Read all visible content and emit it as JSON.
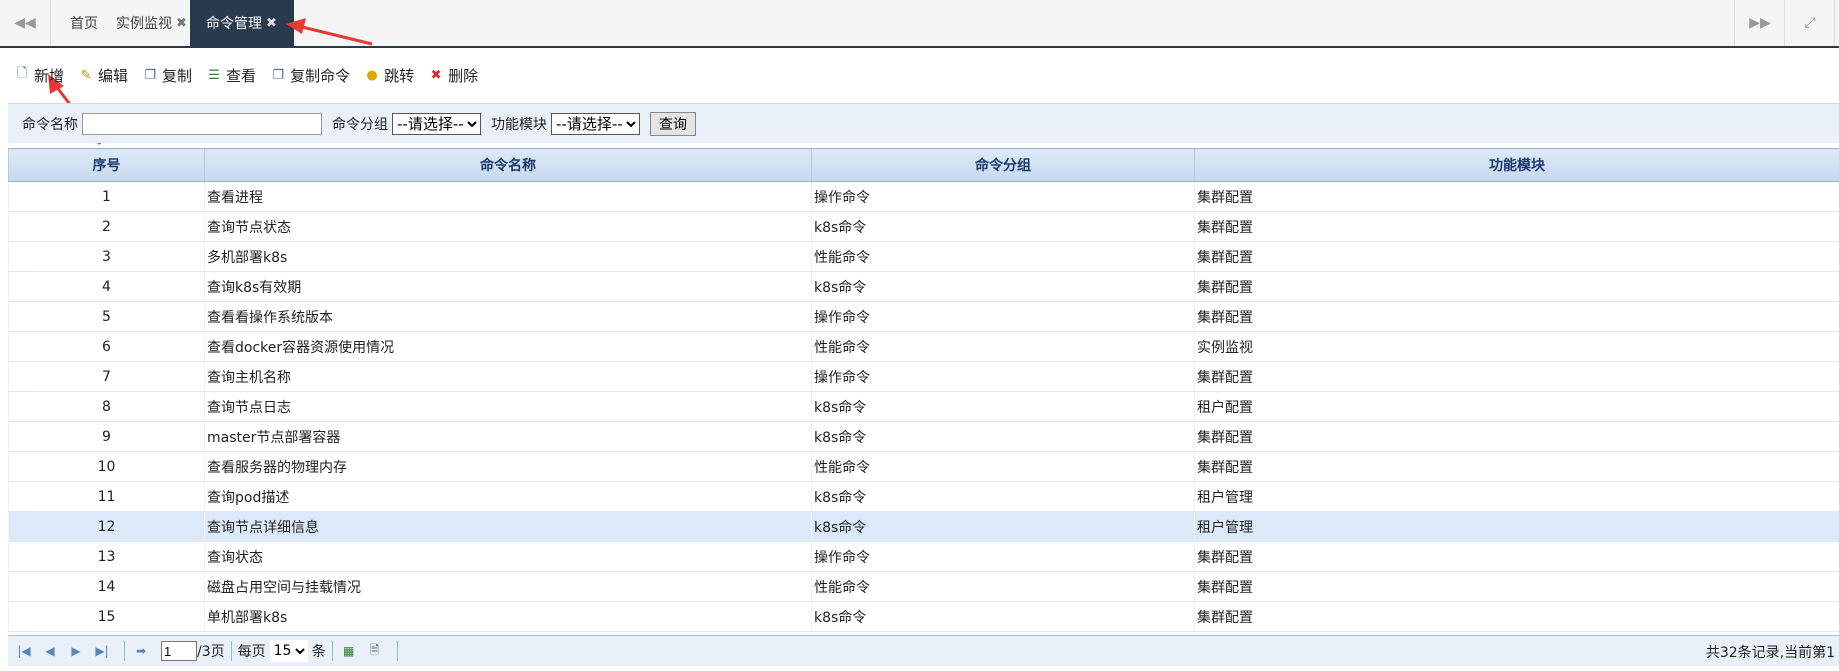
{
  "tabs": [
    {
      "label": "首页",
      "closable": false
    },
    {
      "label": "实例监视",
      "closable": true
    },
    {
      "label": "命令管理",
      "closable": true
    }
  ],
  "toolbar": {
    "add": "新增",
    "edit": "编辑",
    "copy": "复制",
    "view": "查看",
    "copy_cmd": "复制命令",
    "jump": "跳转",
    "delete": "删除"
  },
  "search": {
    "name_label": "命令名称",
    "name_value": "",
    "group_label": "命令分组",
    "group_select": "--请选择--",
    "module_label": "功能模块",
    "module_select": "--请选择--",
    "query_button": "查询"
  },
  "table": {
    "headers": [
      "序号",
      "命令名称",
      "命令分组",
      "功能模块"
    ],
    "rows": [
      [
        "1",
        "查看进程",
        "操作命令",
        "集群配置"
      ],
      [
        "2",
        "查询节点状态",
        "k8s命令",
        "集群配置"
      ],
      [
        "3",
        "多机部署k8s",
        "性能命令",
        "集群配置"
      ],
      [
        "4",
        "查询k8s有效期",
        "k8s命令",
        "集群配置"
      ],
      [
        "5",
        "查看看操作系统版本",
        "操作命令",
        "集群配置"
      ],
      [
        "6",
        "查看docker容器资源使用情况",
        "性能命令",
        "实例监视"
      ],
      [
        "7",
        "查询主机名称",
        "操作命令",
        "集群配置"
      ],
      [
        "8",
        "查询节点日志",
        "k8s命令",
        "租户配置"
      ],
      [
        "9",
        "master节点部署容器",
        "k8s命令",
        "集群配置"
      ],
      [
        "10",
        "查看服务器的物理内存",
        "性能命令",
        "集群配置"
      ],
      [
        "11",
        "查询pod描述",
        "k8s命令",
        "租户管理"
      ],
      [
        "12",
        "查询节点详细信息",
        "k8s命令",
        "租户管理"
      ],
      [
        "13",
        "查询状态",
        "操作命令",
        "集群配置"
      ],
      [
        "14",
        "磁盘占用空间与挂载情况",
        "性能命令",
        "集群配置"
      ],
      [
        "15",
        "单机部署k8s",
        "k8s命令",
        "集群配置"
      ]
    ],
    "selected_row": 12
  },
  "pager": {
    "page": "1",
    "total_pages_text": "/3页",
    "per_page_label": "每页",
    "per_page_value": "15",
    "unit": "条",
    "summary": "共32条记录,当前第1"
  },
  "colors": {
    "accent": "#2a3a4d",
    "header_bg": "#c6d9ef",
    "annotation_arrow": "#e53935"
  }
}
